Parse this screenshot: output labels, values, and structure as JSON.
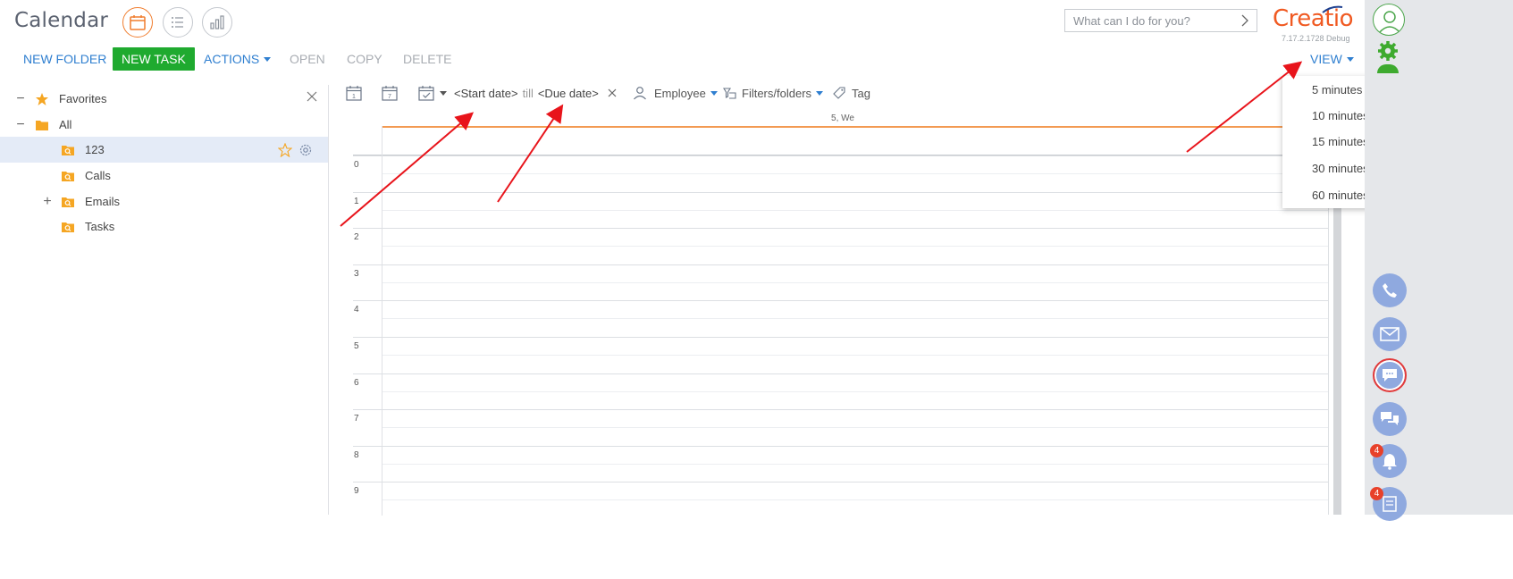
{
  "header": {
    "title": "Calendar",
    "search_placeholder": "What can I do for you?",
    "logo": "Creatio",
    "version": "7.17.2.1728 Debug"
  },
  "toolbar": {
    "new_folder": "NEW FOLDER",
    "new_task": "NEW TASK",
    "actions": "ACTIONS",
    "open": "OPEN",
    "copy": "COPY",
    "delete": "DELETE",
    "view": "VIEW"
  },
  "tree": {
    "favorites": "Favorites",
    "all": "All",
    "items": [
      "123",
      "Calls",
      "Emails",
      "Tasks"
    ]
  },
  "calendar_toolbar": {
    "start_date": "<Start date>",
    "till": "till",
    "due_date": "<Due date>",
    "employee": "Employee",
    "filters_folders": "Filters/folders",
    "tag": "Tag",
    "day_icon_number": "1",
    "week_icon_number": "7"
  },
  "calendar": {
    "day_header": "5, We",
    "hours": [
      "0",
      "1",
      "2",
      "3",
      "4",
      "5",
      "6",
      "7",
      "8",
      "9"
    ]
  },
  "view_menu": {
    "options": [
      "5 minutes",
      "10 minutes",
      "15 minutes",
      "30 minutes",
      "60 minutes"
    ]
  },
  "right_panel": {
    "notification_badge": "4",
    "task_badge": "4"
  },
  "colors": {
    "accent_orange": "#f07d2e",
    "link_blue": "#2f7fd0",
    "primary_green": "#1faa2f",
    "logo_red": "#f05a22",
    "arrow_red": "#e8141b"
  }
}
